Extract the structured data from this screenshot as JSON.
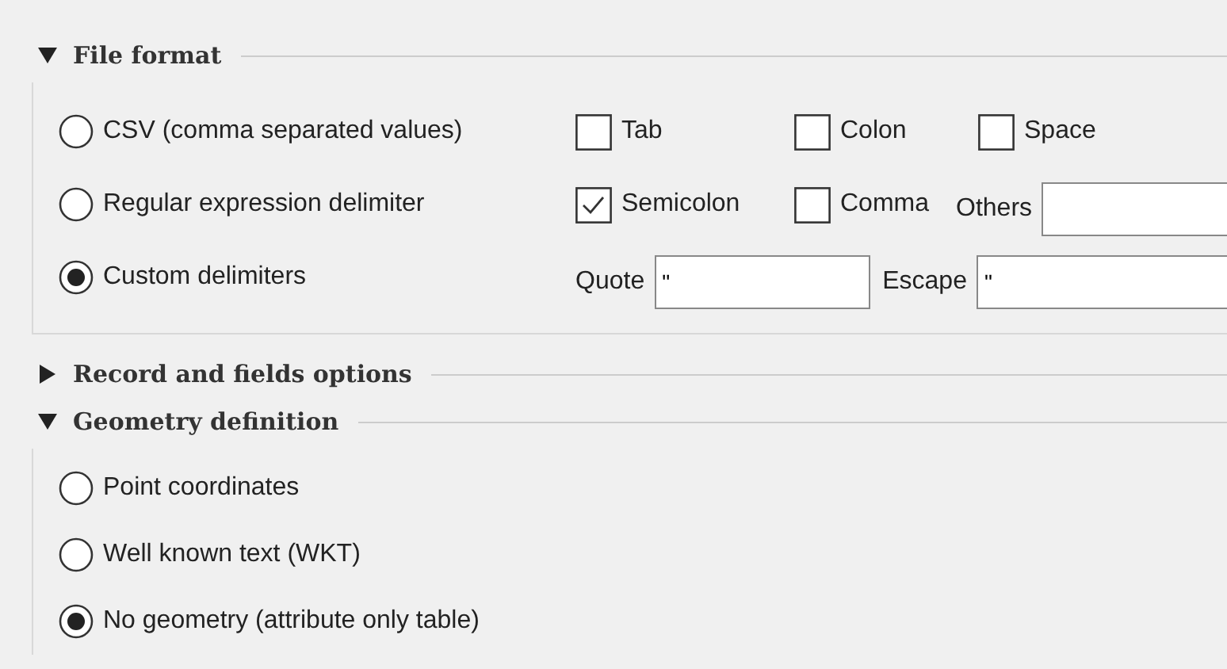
{
  "sections": [
    {
      "title": "File format",
      "expanded": true,
      "radios": [
        {
          "label": "CSV (comma separated values)",
          "selected": false
        },
        {
          "label": "Regular expression delimiter",
          "selected": false
        },
        {
          "label": "Custom delimiters",
          "selected": true
        }
      ],
      "delimiters": {
        "checkboxes": [
          {
            "label": "Tab",
            "checked": false
          },
          {
            "label": "Colon",
            "checked": false
          },
          {
            "label": "Space",
            "checked": false
          },
          {
            "label": "Semicolon",
            "checked": true
          },
          {
            "label": "Comma",
            "checked": false
          }
        ],
        "others": {
          "label": "Others"
        },
        "quote": {
          "label": "Quote",
          "value": "\""
        },
        "escape": {
          "label": "Escape",
          "value": "\""
        }
      }
    },
    {
      "title": "Record and fields options",
      "expanded": false
    },
    {
      "title": "Geometry definition",
      "expanded": true,
      "radios": [
        {
          "label": "Point coordinates",
          "selected": false
        },
        {
          "label": "Well known text (WKT)",
          "selected": false
        },
        {
          "label": "No geometry (attribute only table)",
          "selected": true
        }
      ]
    }
  ]
}
